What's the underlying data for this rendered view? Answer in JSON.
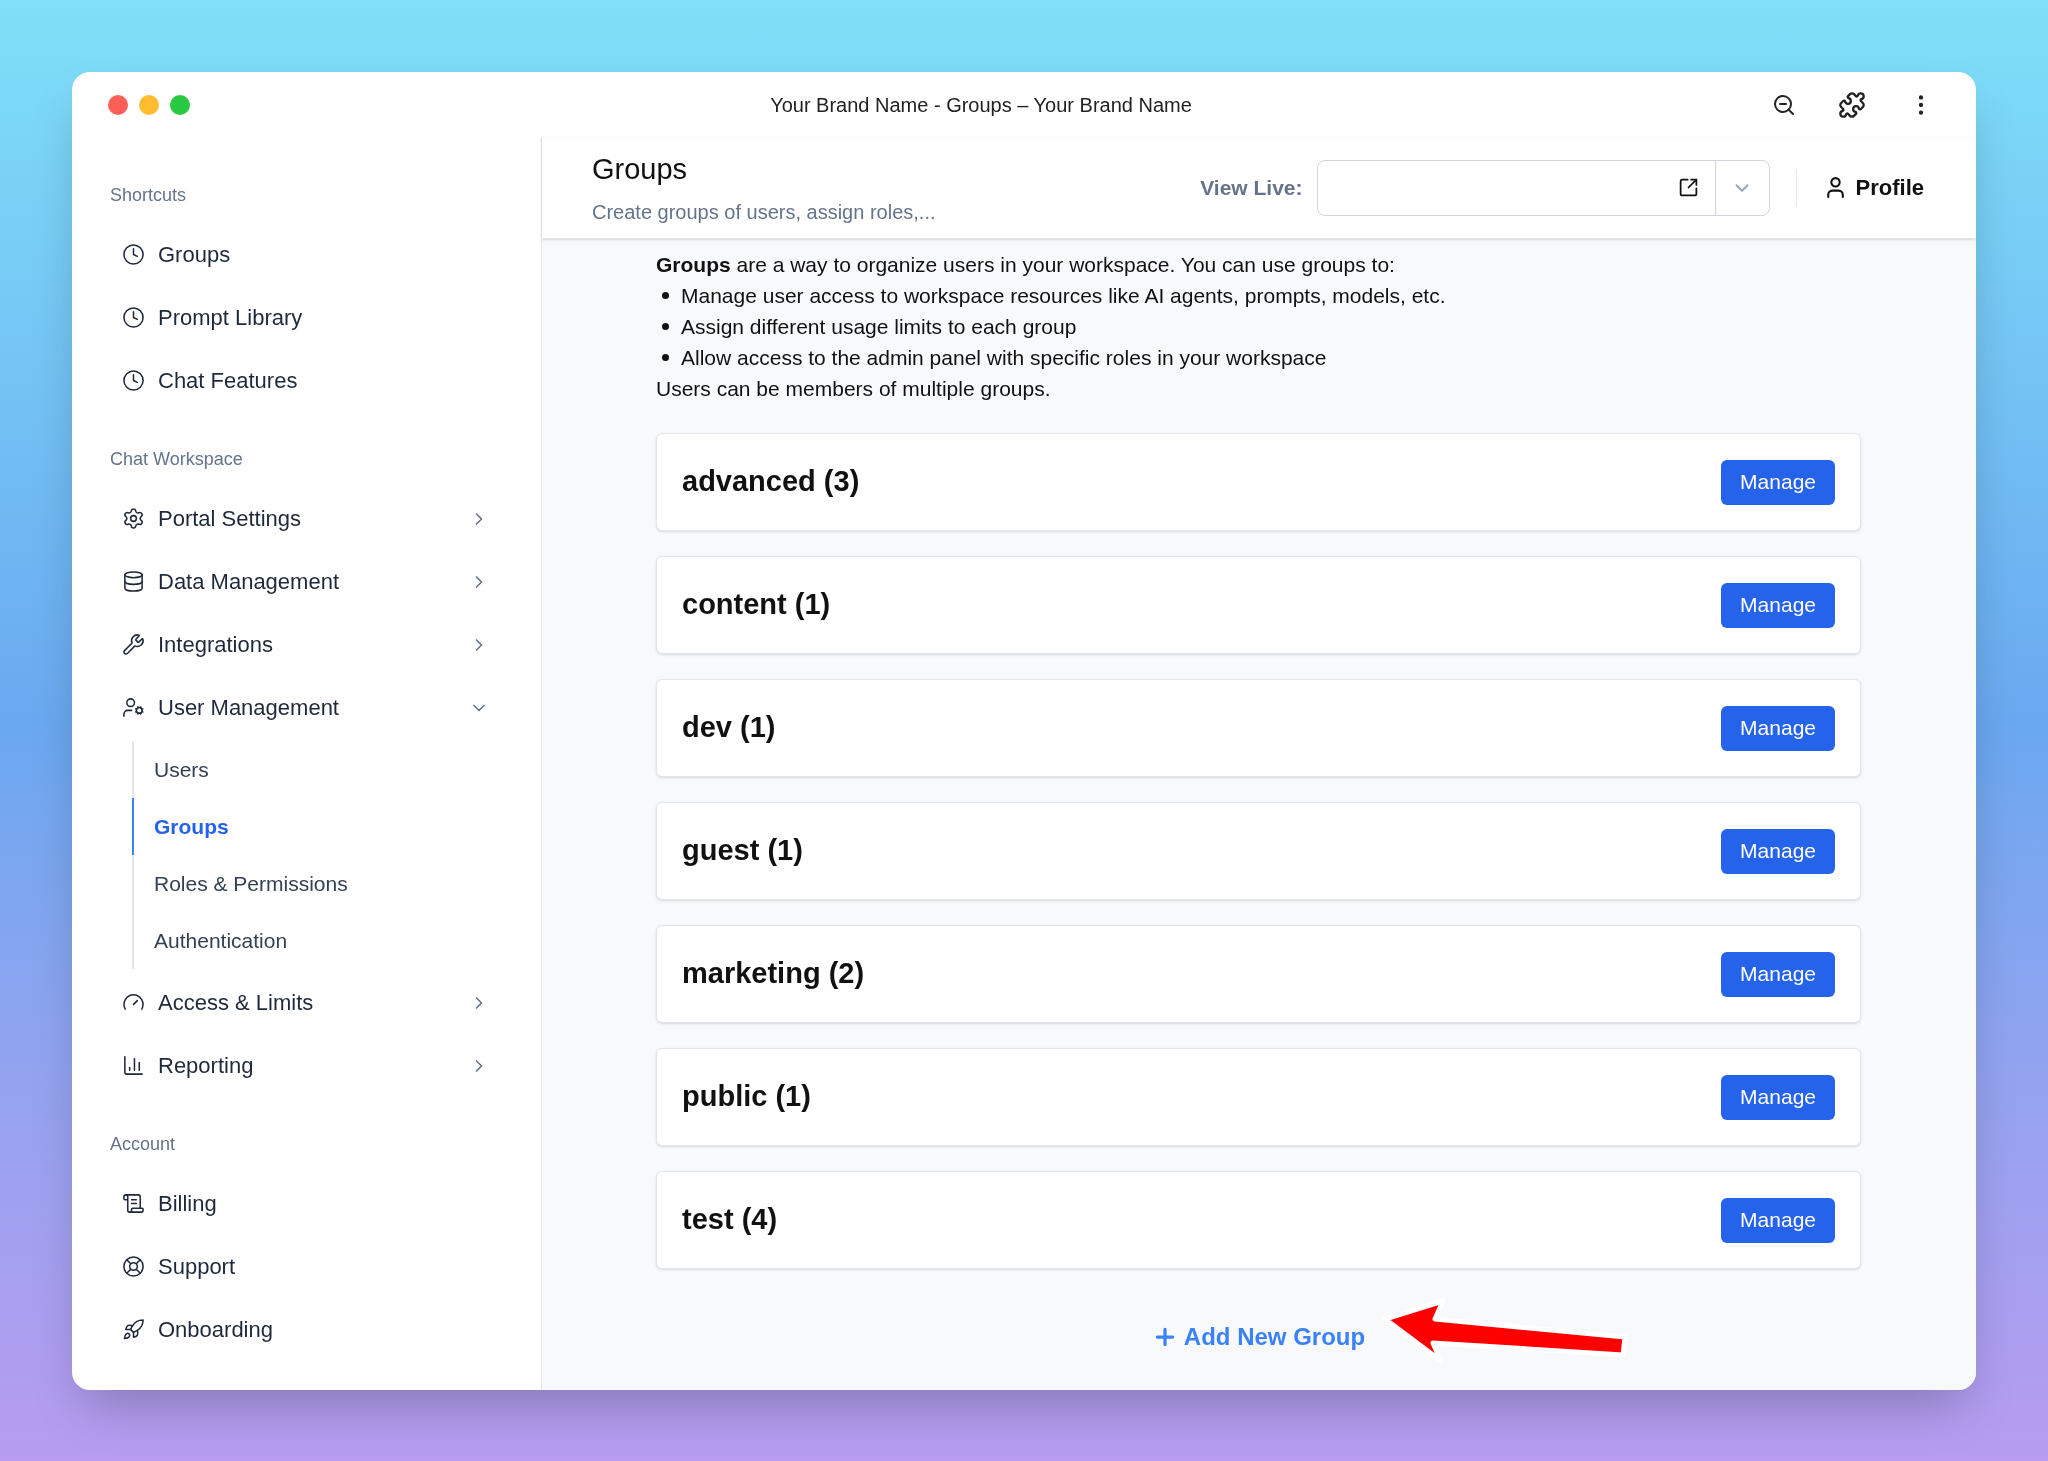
{
  "window": {
    "title": "Your Brand Name - Groups – Your Brand Name"
  },
  "sidebar": {
    "sections": [
      {
        "label": "Shortcuts",
        "items": [
          {
            "label": "Groups"
          },
          {
            "label": "Prompt Library"
          },
          {
            "label": "Chat Features"
          }
        ]
      },
      {
        "label": "Chat Workspace",
        "items": [
          {
            "label": "Portal Settings",
            "expanded": false
          },
          {
            "label": "Data Management",
            "expanded": false
          },
          {
            "label": "Integrations",
            "expanded": false
          },
          {
            "label": "User Management",
            "expanded": true,
            "children": [
              {
                "label": "Users",
                "selected": false
              },
              {
                "label": "Groups",
                "selected": true
              },
              {
                "label": "Roles & Permissions",
                "selected": false
              },
              {
                "label": "Authentication",
                "selected": false
              }
            ]
          },
          {
            "label": "Access & Limits",
            "expanded": false
          },
          {
            "label": "Reporting",
            "expanded": false
          }
        ]
      },
      {
        "label": "Account",
        "items": [
          {
            "label": "Billing"
          },
          {
            "label": "Support"
          },
          {
            "label": "Onboarding"
          }
        ]
      }
    ]
  },
  "header": {
    "title": "Groups",
    "subtitle": "Create groups of users, assign roles,...",
    "view_live_label": "View Live:",
    "profile": "Profile"
  },
  "intro": {
    "lead": "**Groups** are a way to organize users in your workspace. You can use groups to:",
    "bullets": [
      "Manage user access to workspace resources like AI agents, prompts, models, etc.",
      "Assign different usage limits to each group",
      "Allow access to the admin panel with specific roles in your workspace"
    ],
    "closing": "Users can be members of multiple groups."
  },
  "groups": [
    {
      "name": "advanced (3)",
      "action": "Manage"
    },
    {
      "name": "content (1)",
      "action": "Manage"
    },
    {
      "name": "dev (1)",
      "action": "Manage"
    },
    {
      "name": "guest (1)",
      "action": "Manage"
    },
    {
      "name": "marketing (2)",
      "action": "Manage"
    },
    {
      "name": "public (1)",
      "action": "Manage"
    },
    {
      "name": "test (4)",
      "action": "Manage"
    }
  ],
  "add_button": "Add New Group"
}
